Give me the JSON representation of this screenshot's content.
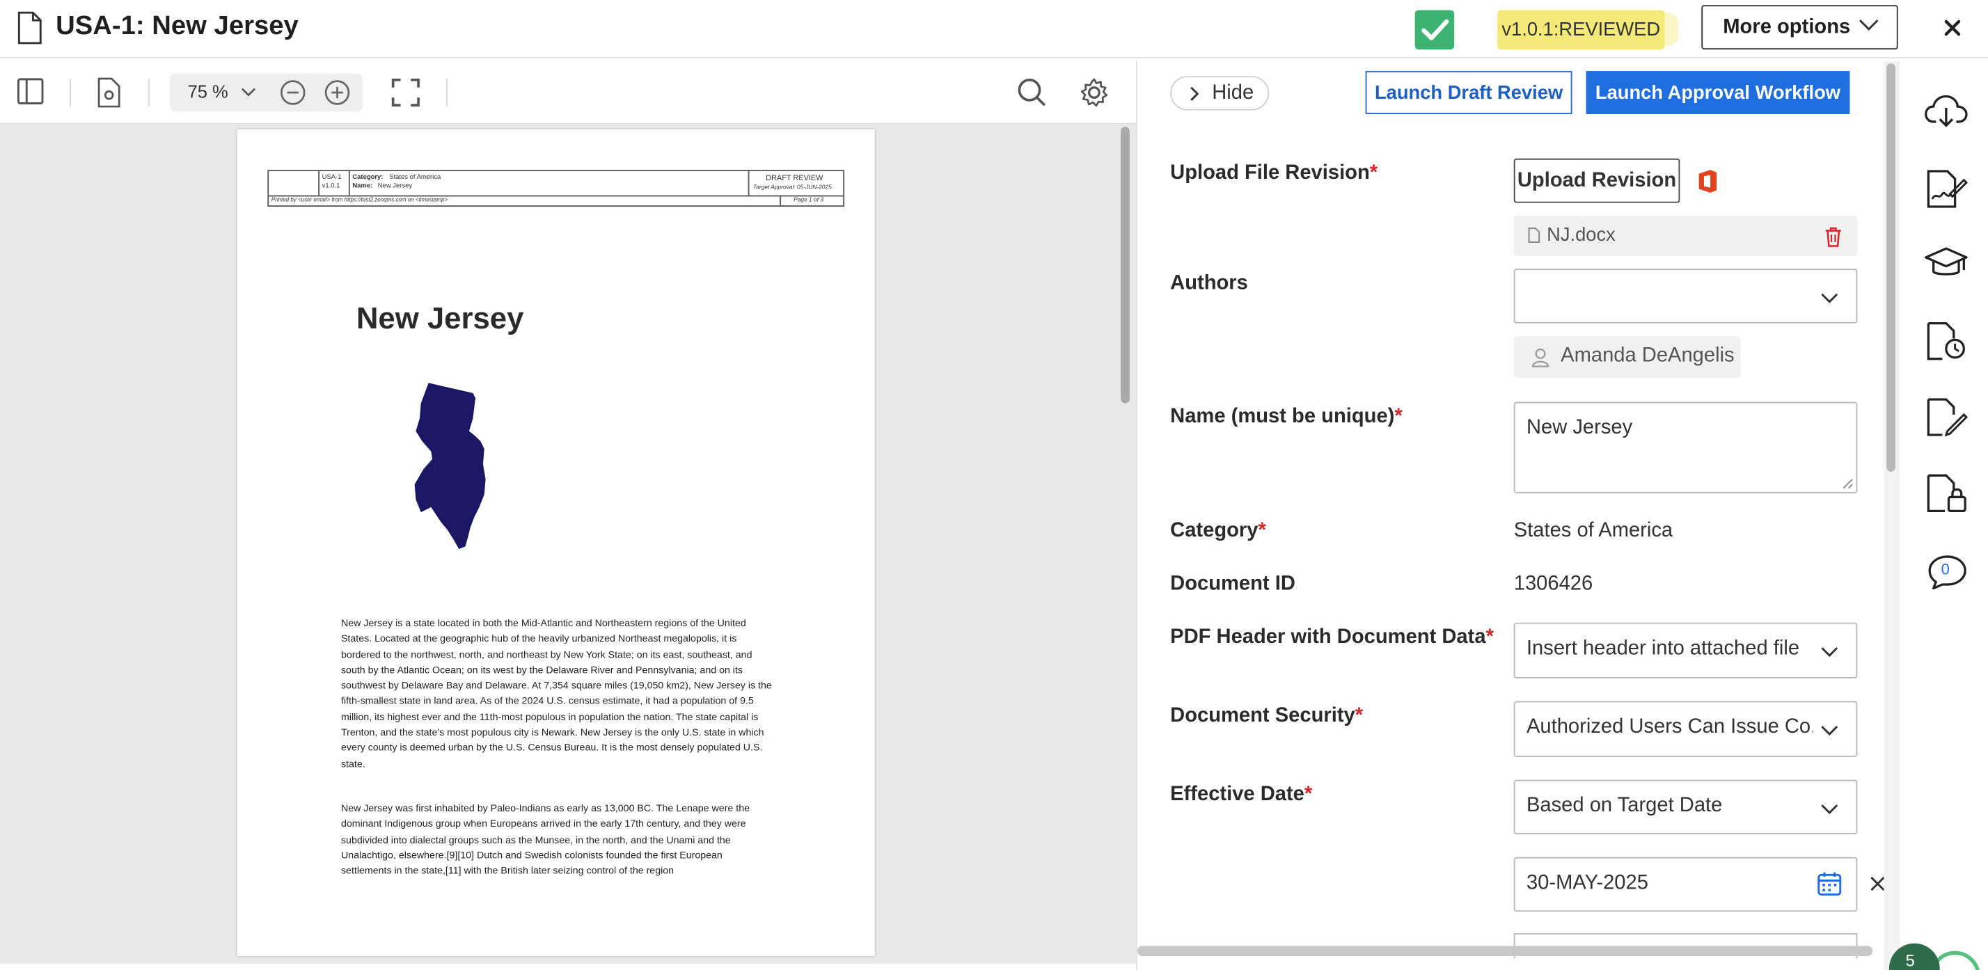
{
  "header": {
    "title": "USA-1: New Jersey",
    "status": "v1.0.1:REVIEWED",
    "more_options": "More options"
  },
  "toolbar": {
    "zoom": "75 %"
  },
  "document": {
    "header_table": {
      "doc_id": "USA-1",
      "version": "v1.0.1",
      "category_label": "Category:",
      "category": "States of America",
      "name_label": "Name:",
      "name": "New Jersey",
      "stage": "DRAFT REVIEW",
      "target": "Target Approval: 05-JUN-2025",
      "printed_by": "Printed by <user email> from https://test2.zenqms.com on <timestamp>",
      "page": "Page 1 of 3"
    },
    "title": "New Jersey",
    "paragraph_1": "New Jersey is a state located in both the Mid-Atlantic and Northeastern regions of the United States. Located at the geographic hub of the heavily urbanized Northeast megalopolis, it is bordered to the northwest, north, and northeast by New York State; on its east, southeast, and south by the Atlantic Ocean; on its west by the Delaware River and Pennsylvania; and on its southwest by Delaware Bay and Delaware. At 7,354 square miles (19,050 km2), New Jersey is the fifth-smallest state in land area. As of the 2024 U.S. census estimate, it had a population of 9.5 million, its highest ever and the 11th-most populous in population the nation. The state capital is Trenton, and the state's most populous city is Newark. New Jersey is the only U.S. state in which every county is deemed urban by the U.S. Census Bureau. It is the most densely populated U.S. state.",
    "paragraph_2": "New Jersey was first inhabited by Paleo-Indians as early as 13,000 BC. The Lenape were the dominant Indigenous group when Europeans arrived in the early 17th century, and they were subdivided into dialectal groups such as the Munsee, in the north, and the Unami and the Unalachtigo, elsewhere.[9][10] Dutch and Swedish colonists founded the first European settlements in the state,[11] with the British later seizing control of the region"
  },
  "panel": {
    "hide": "Hide",
    "launch_draft_review": "Launch Draft Review",
    "launch_approval_workflow": "Launch Approval Workflow",
    "upload_file_revision_label": "Upload File Revision",
    "upload_revision": "Upload Revision",
    "file_name": "NJ.docx",
    "authors_label": "Authors",
    "authors_value": "",
    "author": "Amanda DeAngelis",
    "name_label": "Name (must be unique)",
    "name_value": "New Jersey",
    "category_label": "Category",
    "category_value": "States of America",
    "document_id_label": "Document ID",
    "document_id_value": "1306426",
    "pdf_header_label": "PDF Header with Document Data",
    "pdf_header_value": "Insert header into attached file",
    "document_security_label": "Document Security",
    "document_security_value": "Authorized Users Can Issue Co...",
    "effective_date_label": "Effective Date",
    "effective_date_value": "Based on Target Date",
    "date_value": "30-MAY-2025",
    "required_mark": "*"
  },
  "rail": {
    "comment_count": "0",
    "notification_count": "5"
  },
  "colors": {
    "primary": "#1f6ee0",
    "status_chip": "#f3ea7a",
    "required": "#d6262b",
    "state_fill": "#1c1764"
  },
  "icons": [
    "document-icon",
    "check-icon",
    "chevron-down-icon",
    "close-icon",
    "sidebar-toggle-icon",
    "settings-file-icon",
    "zoom-out-icon",
    "zoom-in-icon",
    "fullscreen-icon",
    "search-icon",
    "gear-icon",
    "chevron-right-icon",
    "office-icon",
    "file-icon",
    "trash-icon",
    "user-icon",
    "calendar-icon",
    "cloud-download-icon",
    "signature-icon",
    "graduation-cap-icon",
    "file-history-icon",
    "file-edit-icon",
    "file-lock-icon",
    "comment-icon"
  ]
}
